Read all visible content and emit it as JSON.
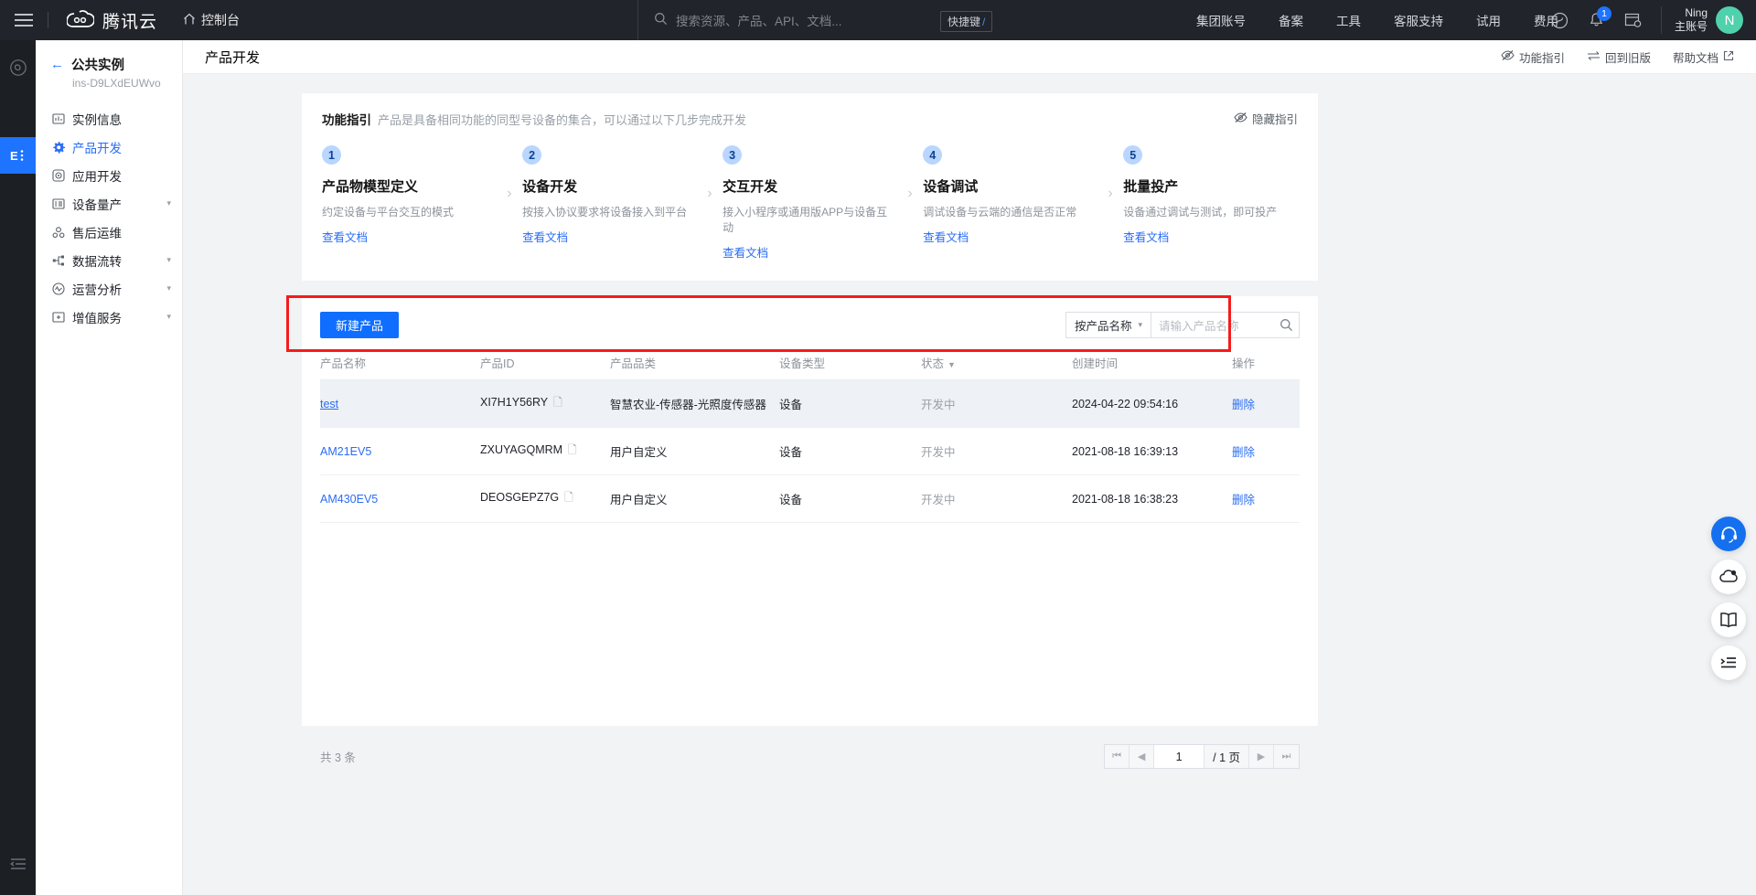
{
  "topbar": {
    "menu_icon": "hamburger-menu-icon",
    "brand": "腾讯云",
    "console": "控制台",
    "search_placeholder": "搜索资源、产品、API、文档...",
    "shortcut_label": "快捷键",
    "shortcut_key": "/",
    "nav": [
      {
        "label": "集团账号"
      },
      {
        "label": "备案"
      },
      {
        "label": "工具"
      },
      {
        "label": "客服支持"
      },
      {
        "label": "试用"
      },
      {
        "label": "费用"
      }
    ],
    "notification_count": "1",
    "user_name": "Ning",
    "user_role": "主账号",
    "avatar_letter": "N"
  },
  "sidebar": {
    "back_label": "公共实例",
    "instance_id": "ins-D9LXdEUWvo",
    "items": [
      {
        "label": "实例信息",
        "icon": "instance-info-icon",
        "active": false,
        "expandable": false
      },
      {
        "label": "产品开发",
        "icon": "gear-icon",
        "active": true,
        "expandable": false
      },
      {
        "label": "应用开发",
        "icon": "target-icon",
        "active": false,
        "expandable": false
      },
      {
        "label": "设备量产",
        "icon": "list-icon",
        "active": false,
        "expandable": true
      },
      {
        "label": "售后运维",
        "icon": "wrench-icon",
        "active": false,
        "expandable": false
      },
      {
        "label": "数据流转",
        "icon": "flow-icon",
        "active": false,
        "expandable": true
      },
      {
        "label": "运营分析",
        "icon": "analytics-icon",
        "active": false,
        "expandable": true
      },
      {
        "label": "增值服务",
        "icon": "value-add-icon",
        "active": false,
        "expandable": true
      }
    ]
  },
  "page": {
    "title": "产品开发",
    "actions": [
      {
        "label": "功能指引",
        "icon": "eye-off-icon"
      },
      {
        "label": "回到旧版",
        "icon": "swap-icon"
      },
      {
        "label": "帮助文档",
        "icon": "external-link-icon"
      }
    ]
  },
  "guide": {
    "title": "功能指引",
    "subtitle": "产品是具备相同功能的同型号设备的集合，可以通过以下几步完成开发",
    "hide_label": "隐藏指引",
    "doc_link": "查看文档",
    "steps": [
      {
        "num": "1",
        "name": "产品物模型定义",
        "desc": "约定设备与平台交互的模式"
      },
      {
        "num": "2",
        "name": "设备开发",
        "desc": "按接入协议要求将设备接入到平台"
      },
      {
        "num": "3",
        "name": "交互开发",
        "desc": "接入小程序或通用版APP与设备互动"
      },
      {
        "num": "4",
        "name": "设备调试",
        "desc": "调试设备与云端的通信是否正常"
      },
      {
        "num": "5",
        "name": "批量投产",
        "desc": "设备通过调试与测试，即可投产"
      }
    ]
  },
  "toolbar": {
    "create_label": "新建产品",
    "filter_label": "按产品名称",
    "search_placeholder": "请输入产品名称"
  },
  "table": {
    "columns": [
      {
        "label": "产品名称",
        "sortable": false
      },
      {
        "label": "产品ID",
        "sortable": false
      },
      {
        "label": "产品品类",
        "sortable": false
      },
      {
        "label": "设备类型",
        "sortable": false
      },
      {
        "label": "状态",
        "sortable": true
      },
      {
        "label": "创建时间",
        "sortable": false
      },
      {
        "label": "操作",
        "sortable": false
      }
    ],
    "rows": [
      {
        "name": "test",
        "id": "XI7H1Y56RY",
        "category": "智慧农业-传感器-光照度传感器",
        "device_type": "设备",
        "status": "开发中",
        "created": "2024-04-22 09:54:16",
        "action": "删除",
        "highlighted": true
      },
      {
        "name": "AM21EV5",
        "id": "ZXUYAGQMRM",
        "category": "用户自定义",
        "device_type": "设备",
        "status": "开发中",
        "created": "2021-08-18 16:39:13",
        "action": "删除",
        "highlighted": false
      },
      {
        "name": "AM430EV5",
        "id": "DEOSGEPZ7G",
        "category": "用户自定义",
        "device_type": "设备",
        "status": "开发中",
        "created": "2021-08-18 16:38:23",
        "action": "删除",
        "highlighted": false
      }
    ]
  },
  "pager": {
    "total_text": "共 3 条",
    "current_page": "1",
    "total_pages": "/ 1 页"
  },
  "fabs": [
    {
      "icon": "headset-support-icon",
      "primary": true
    },
    {
      "icon": "cloud-feedback-icon",
      "primary": false
    },
    {
      "icon": "book-docs-icon",
      "primary": false
    },
    {
      "icon": "list-panel-icon",
      "primary": false
    }
  ],
  "colors": {
    "accent": "#1e73ff",
    "link": "#2a6df5",
    "highlight_border": "#f61b1b",
    "topbar_bg": "#21242a",
    "avatar_bg": "#4fd1ac"
  }
}
